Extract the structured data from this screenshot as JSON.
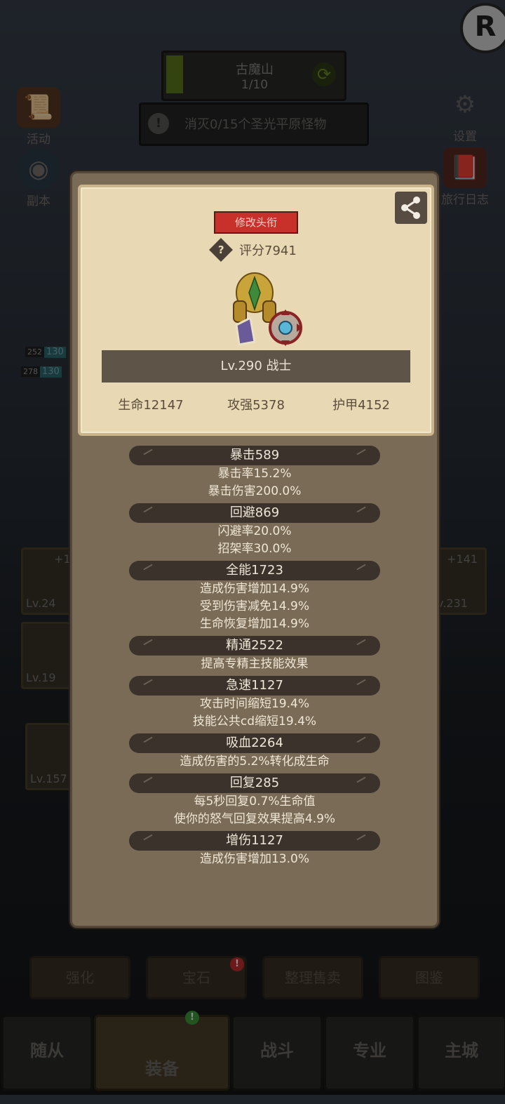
{
  "background": {
    "zone": {
      "name": "古魔山",
      "progress": "1/10"
    },
    "quest": {
      "text": "消灭0/15个圣光平原怪物"
    },
    "left_buttons": [
      {
        "label": "活动",
        "icon": "scroll-icon"
      },
      {
        "label": "副本",
        "icon": "portal-icon"
      }
    ],
    "right_buttons": [
      {
        "label": "设置",
        "icon": "gear-icon"
      },
      {
        "label": "旅行日志",
        "icon": "book-icon"
      }
    ],
    "hp_bars": [
      {
        "level": "252",
        "value": "130"
      },
      {
        "level": "278",
        "value": "130"
      }
    ],
    "left_cards": [
      {
        "level": "Lv.24",
        "plus": "+1"
      },
      {
        "level": "Lv.19"
      },
      {
        "level": "Lv.157"
      }
    ],
    "right_cards": [
      {
        "level": "v.231",
        "plus": "+141"
      }
    ],
    "sub_buttons": [
      "强化",
      "宝石",
      "整理售卖",
      "图鉴"
    ],
    "nav": [
      "随从",
      "装备",
      "战斗",
      "专业",
      "主城"
    ]
  },
  "profile": {
    "rename_button": "修改头衔",
    "score": "评分7941",
    "level_class": "Lv.290 战士",
    "stats": {
      "hp": "生命12147",
      "attack": "攻强5378",
      "armor": "护甲4152"
    }
  },
  "attributes": [
    {
      "title": "暴击589",
      "lines": [
        "暴击率15.2%",
        "暴击伤害200.0%"
      ]
    },
    {
      "title": "回避869",
      "lines": [
        "闪避率20.0%",
        "招架率30.0%"
      ]
    },
    {
      "title": "全能1723",
      "lines": [
        "造成伤害增加14.9%",
        "受到伤害减免14.9%",
        "生命恢复增加14.9%"
      ]
    },
    {
      "title": "精通2522",
      "lines": [
        "提高专精主技能效果"
      ]
    },
    {
      "title": "急速1127",
      "lines": [
        "攻击时间缩短19.4%",
        "技能公共cd缩短19.4%"
      ]
    },
    {
      "title": "吸血2264",
      "lines": [
        "造成伤害的5.2%转化成生命"
      ]
    },
    {
      "title": "回复285",
      "lines": [
        "每5秒回复0.7%生命值",
        "使你的怒气回复效果提高4.9%"
      ]
    },
    {
      "title": "增伤1127",
      "lines": [
        "造成伤害增加13.0%"
      ]
    }
  ],
  "colors": {
    "rename_red": "#c8302a",
    "parchment": "#e8d8b4",
    "panel": "#7a6b56",
    "badge_red": "#c62f2f",
    "badge_green": "#3f9a3a"
  }
}
